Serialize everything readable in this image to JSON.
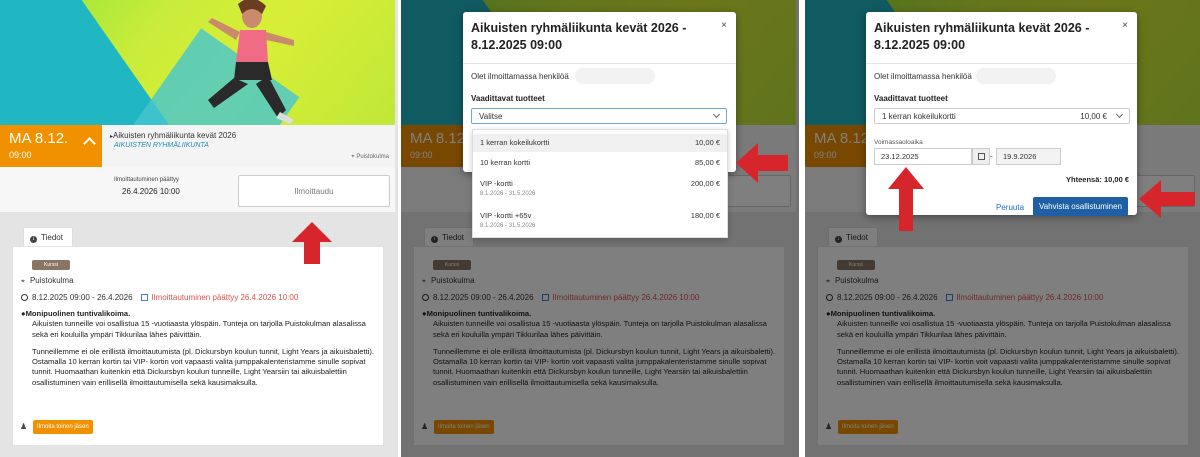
{
  "event": {
    "date_day": "MA 8.12.",
    "time": "09:00",
    "title": "Aikuisten ryhmäliikunta kevät 2026",
    "subtitle": "AIKUISTEN RYHMÄLIIKUNTA",
    "location": "Puistokulma",
    "registration_label": "Ilmoittautuminen päättyy",
    "registration_end": "26.4.2026 10:00",
    "register_button": "Ilmoittaudu"
  },
  "details": {
    "tab_label": "Tiedot",
    "badge": "Kurssi",
    "location": "Puistokulma",
    "date_range": "8.12.2025 09:00 - 26.4.2026",
    "registration_ended": "Ilmoittautuminen päättyy 26.4.2026 10:00",
    "heading": "Monipuolinen tuntivalikoima.",
    "paragraph1": "Aikuisten tunneille voi osallistua 15 -vuotiaasta ylöspäin. Tunteja on tarjolla Puistokulman alasalissa sekä eri kouluilla ympäri Tikkurilaa lähes päivittäin.",
    "paragraph2": "Tunneillemme ei ole erillistä ilmoittautumista (pl. Dickursbyn koulun tunnit, Light Years ja aikuisbaletti). Ostamalla 10 kerran kortin tai VIP- kortin voit vapaasti valita jumppakalenteristamme sinulle sopivat tunnit. Huomaathan kuitenkin että Dickursbyn koulun tunneille, Light Yearsiin tai aikuisbalettiin osallistuminen vain erillisellä ilmoittautumisella sekä kausimaksulla.",
    "member_button": "Ilmoita toinen jäsen"
  },
  "modal": {
    "title": "Aikuisten ryhmäliikunta kevät 2026 - 8.12.2025 09:00",
    "close": "×",
    "registering_text": "Olet ilmoittamassa henkilöä",
    "required_label": "Vaadittavat tuotteet",
    "select_placeholder": "Valitse",
    "options": [
      {
        "label": "1 kerran kokeilukortti",
        "price": "10,00 €",
        "validity": ""
      },
      {
        "label": "10 kerran kortti",
        "price": "85,00 €",
        "validity": ""
      },
      {
        "label": "VIP -kortti",
        "price": "200,00 €",
        "validity": "8.1.2026 - 31.5.2026"
      },
      {
        "label": "VIP -kortti +65v",
        "price": "180,00 €",
        "validity": "8.1.2026 - 31.5.2026"
      }
    ],
    "selected_option": "1 kerran kokeilukortti",
    "selected_price": "10,00 €",
    "validity_label": "Voimassaoloaika",
    "valid_from": "23.12.2025",
    "valid_to": "19.9.2026",
    "date_separator": "-",
    "total": "Yhteensä: 10,00 €",
    "cancel_button": "Peruuta",
    "confirm_button": "Vahvista osallistuminen"
  },
  "colors": {
    "accent_orange": "#f29100",
    "link_blue": "#1e6fc0",
    "confirm_blue": "#1e5fa6",
    "arrow_red": "#d7262b"
  }
}
